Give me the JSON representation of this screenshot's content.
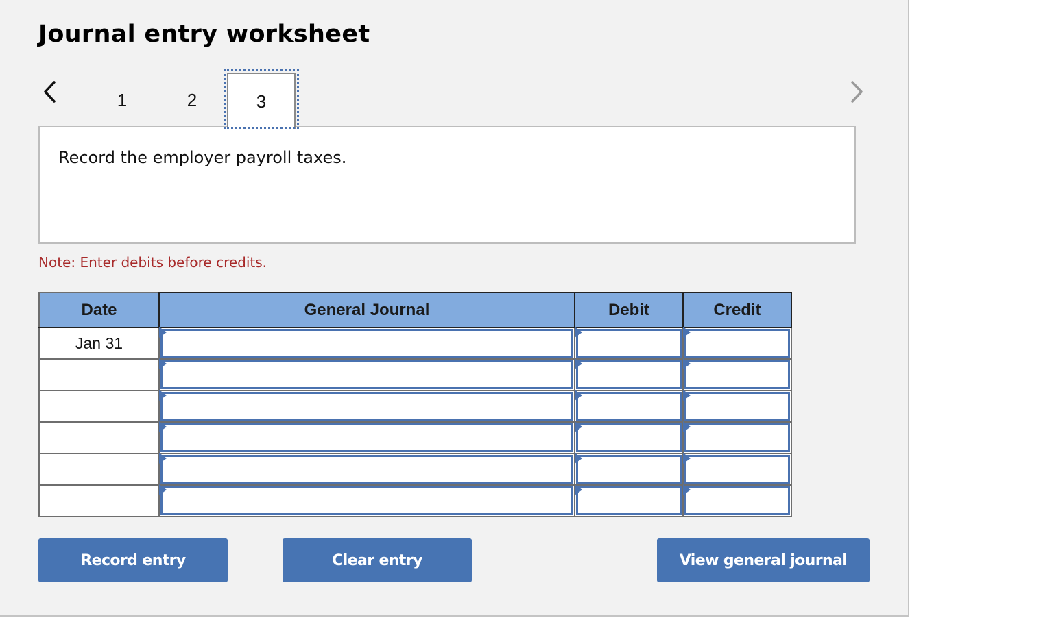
{
  "worksheet": {
    "title": "Journal entry worksheet",
    "tabs": [
      {
        "label": "1",
        "active": false
      },
      {
        "label": "2",
        "active": false
      },
      {
        "label": "3",
        "active": true
      }
    ],
    "prev_icon": "chevron-left-icon",
    "next_icon": "chevron-right-icon",
    "next_disabled": true,
    "prompt": "Record the employer payroll taxes.",
    "note": "Note: Enter debits before credits."
  },
  "journal": {
    "columns": [
      "Date",
      "General Journal",
      "Debit",
      "Credit"
    ],
    "rows": [
      {
        "date": "Jan 31",
        "account": "",
        "debit": "",
        "credit": ""
      },
      {
        "date": "",
        "account": "",
        "debit": "",
        "credit": ""
      },
      {
        "date": "",
        "account": "",
        "debit": "",
        "credit": ""
      },
      {
        "date": "",
        "account": "",
        "debit": "",
        "credit": ""
      },
      {
        "date": "",
        "account": "",
        "debit": "",
        "credit": ""
      },
      {
        "date": "",
        "account": "",
        "debit": "",
        "credit": ""
      }
    ]
  },
  "buttons": {
    "record": "Record entry",
    "clear": "Clear entry",
    "view": "View general journal"
  },
  "colors": {
    "header_blue": "#82abde",
    "input_border": "#4a72b0",
    "button_blue": "#4774b3",
    "note_red": "#a82a2a",
    "panel_bg": "#f2f2f2"
  }
}
